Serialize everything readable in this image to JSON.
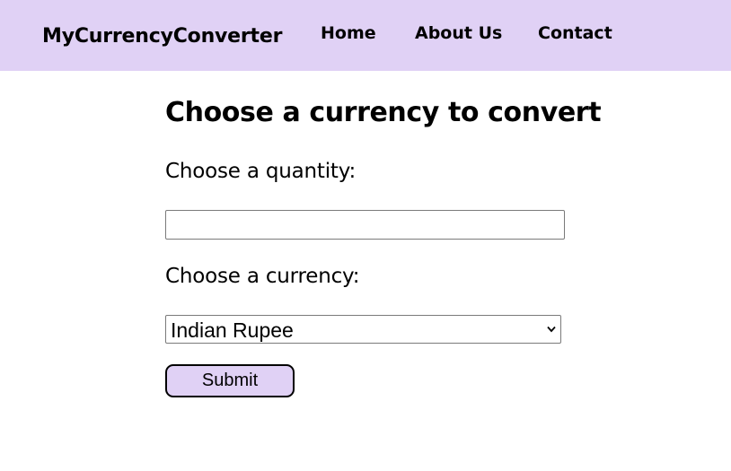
{
  "navbar": {
    "brand": "MyCurrencyConverter",
    "links": [
      {
        "label": "Home"
      },
      {
        "label": "About Us"
      },
      {
        "label": "Contact"
      }
    ],
    "background_color": "#e0d1f5"
  },
  "main": {
    "title": "Choose a currency to convert",
    "quantity": {
      "label": "Choose a quantity:",
      "value": "",
      "placeholder": ""
    },
    "currency": {
      "label": "Choose a currency:",
      "selected": "Indian Rupee",
      "icon": "chevron-down-icon"
    },
    "submit_label": "Submit",
    "submit_color": "#e0d1f5"
  }
}
